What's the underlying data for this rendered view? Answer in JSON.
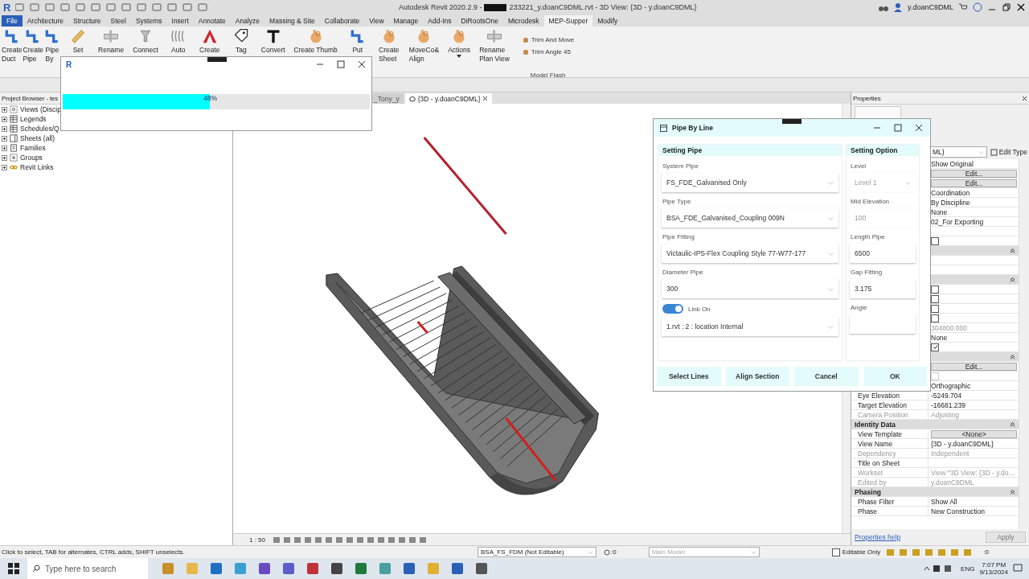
{
  "title_bar": {
    "logo": "R",
    "app": "Autodesk Revit 2020.2.9 -",
    "document": "233221_y.doanC9DML.rvt - 3D View: {3D - y.doanC9DML}",
    "user": "y.doanC9DML"
  },
  "ribbon_tabs": [
    {
      "label": "File",
      "selected": false,
      "kind": "file"
    },
    {
      "label": "Architecture",
      "selected": false,
      "kind": "tab"
    },
    {
      "label": "Structure",
      "selected": false,
      "kind": "tab"
    },
    {
      "label": "Steel",
      "selected": false,
      "kind": "tab"
    },
    {
      "label": "Systems",
      "selected": false,
      "kind": "tab"
    },
    {
      "label": "Insert",
      "selected": false,
      "kind": "tab"
    },
    {
      "label": "Annotate",
      "selected": false,
      "kind": "tab"
    },
    {
      "label": "Analyze",
      "selected": false,
      "kind": "tab"
    },
    {
      "label": "Massing & Site",
      "selected": false,
      "kind": "tab"
    },
    {
      "label": "Collaborate",
      "selected": false,
      "kind": "tab"
    },
    {
      "label": "View",
      "selected": false,
      "kind": "tab"
    },
    {
      "label": "Manage",
      "selected": false,
      "kind": "tab"
    },
    {
      "label": "Add-Ins",
      "selected": false,
      "kind": "tab"
    },
    {
      "label": "DiRootsOne",
      "selected": false,
      "kind": "tab"
    },
    {
      "label": "Microdesk",
      "selected": false,
      "kind": "tab"
    },
    {
      "label": "MEP-Supper",
      "selected": true,
      "kind": "tab"
    },
    {
      "label": "Modify",
      "selected": false,
      "kind": "tab"
    }
  ],
  "ribbon_buttons": [
    {
      "lines": [
        "Create",
        "Duct"
      ],
      "kind": "pipe"
    },
    {
      "lines": [
        "Create",
        "Pipe"
      ],
      "kind": "pipe"
    },
    {
      "lines": [
        "Pipe",
        "By"
      ],
      "kind": "pipe"
    },
    {
      "lines": [
        "Set"
      ],
      "kind": "ruler"
    },
    {
      "lines": [
        "Rename"
      ],
      "kind": "beam"
    },
    {
      "lines": [
        "Connect"
      ],
      "kind": "connect"
    },
    {
      "lines": [
        "Auto"
      ],
      "kind": "spring"
    },
    {
      "lines": [
        "Create"
      ],
      "kind": "triangle"
    },
    {
      "lines": [
        "Tag"
      ],
      "kind": "tag"
    },
    {
      "lines": [
        "Convert"
      ],
      "kind": "tee"
    },
    {
      "lines": [
        "Create Thumb"
      ],
      "kind": "hand"
    },
    {
      "lines": [
        "Put"
      ],
      "kind": "pipe"
    },
    {
      "lines": [
        "Create",
        "Sheet"
      ],
      "kind": "hand"
    },
    {
      "lines": [
        "MoveCo&",
        "Align"
      ],
      "kind": "hand"
    },
    {
      "lines": [
        "Actions"
      ],
      "kind": "hand",
      "dropdown": true
    },
    {
      "lines": [
        "Rename",
        "Plan View"
      ],
      "kind": "beam"
    }
  ],
  "ribbon_small_buttons": [
    "Trim And Move",
    "Trim Angle 45"
  ],
  "ribbon_panel_label": "Model Flash",
  "project_browser": {
    "title": "Project Browser - tes",
    "items": [
      {
        "label": "Views (Discip",
        "kind": "views"
      },
      {
        "label": "Legends",
        "kind": "grid"
      },
      {
        "label": "Schedules/Q",
        "kind": "grid"
      },
      {
        "label": "Sheets (all)",
        "kind": "sheet"
      },
      {
        "label": "Families",
        "kind": "family"
      },
      {
        "label": "Groups",
        "kind": "group"
      },
      {
        "label": "Revit Links",
        "kind": "link"
      }
    ]
  },
  "view_tabs": [
    {
      "label": "_Tony_y",
      "selected": false
    },
    {
      "label": "{3D - y.doanC9DML}",
      "selected": true
    }
  ],
  "view_scale": "1 : 50",
  "properties": {
    "title": "Properties",
    "type_selector": "ML)",
    "edit_type": "Edit Type",
    "rows": [
      {
        "kind": "text",
        "value": "Show Original"
      },
      {
        "kind": "button",
        "value": "Edit..."
      },
      {
        "kind": "button",
        "value": "Edit..."
      },
      {
        "kind": "text",
        "value": "Coordination"
      },
      {
        "kind": "text",
        "value": "By Discipline"
      },
      {
        "kind": "text",
        "value": "None"
      },
      {
        "kind": "text",
        "value": "02_For Exporting"
      },
      {
        "kind": "empty"
      },
      {
        "kind": "checkbox",
        "checked": false,
        "disabled": false
      },
      {
        "kind": "group"
      },
      {
        "kind": "empty"
      },
      {
        "kind": "empty"
      },
      {
        "kind": "group"
      },
      {
        "kind": "checkbox",
        "checked": false,
        "disabled": false
      },
      {
        "kind": "checkbox",
        "checked": false,
        "disabled": false
      },
      {
        "kind": "checkbox",
        "checked": false,
        "disabled": false
      },
      {
        "kind": "checkbox",
        "checked": false,
        "disabled": false
      },
      {
        "kind": "grey",
        "value": "304800.000"
      },
      {
        "kind": "text",
        "value": "None"
      },
      {
        "kind": "checkbox",
        "checked": true,
        "disabled": false
      },
      {
        "kind": "group"
      },
      {
        "kind": "button",
        "value": "Edit..."
      },
      {
        "kind": "checkbox",
        "checked": false,
        "disabled": true
      },
      {
        "kind": "text",
        "value": "Orthographic"
      },
      {
        "kind": "text",
        "label": "Eye Elevation",
        "value": "-5249.704"
      },
      {
        "kind": "text",
        "label": "Target Elevation",
        "value": "-16681.239"
      },
      {
        "kind": "grey",
        "label": "Camera Position",
        "value": "Adjusting"
      },
      {
        "kind": "group",
        "label": "Identity Data"
      },
      {
        "kind": "button",
        "label": "View Template",
        "value": "<None>"
      },
      {
        "kind": "text",
        "label": "View Name",
        "value": "{3D - y.doanC9DML}"
      },
      {
        "kind": "grey",
        "label": "Dependency",
        "value": "Independent"
      },
      {
        "kind": "empty",
        "label": "Title on Sheet"
      },
      {
        "kind": "grey",
        "label": "Workset",
        "value": "View \"3D View: {3D - y.do..."
      },
      {
        "kind": "grey",
        "label": "Edited by",
        "value": "y.doanC9DML"
      },
      {
        "kind": "group",
        "label": "Phasing"
      },
      {
        "kind": "text",
        "label": "Phase Filter",
        "value": "Show All"
      },
      {
        "kind": "text",
        "label": "Phase",
        "value": "New Construction"
      }
    ],
    "help_link": "Properties help",
    "apply": "Apply"
  },
  "status_bar": {
    "message": "Click to select, TAB for alternates, CTRL adds, SHIFT unselects.",
    "workset": "BSA_FS_FDM (Not Editable)",
    "selection_count": ":0",
    "design_option": "Main Model",
    "editable_only": {
      "label": "Editable Only",
      "checked": false
    },
    "filter_count": ":0"
  },
  "taskbar": {
    "search_placeholder": "Type here to search",
    "language": "ENG",
    "time": "7:07 PM",
    "date": "9/13/2024"
  },
  "progress_window": {
    "logo": "R",
    "level": 0.48,
    "percent": "48%"
  },
  "pipe_dialog": {
    "title": "Pipe By Line",
    "left_header": "Setting Pipe",
    "right_header": "Setting Option",
    "left_fields": [
      {
        "kind": "select",
        "label": "System Pipe",
        "value": "FS_FDE_Galvanised Only"
      },
      {
        "kind": "select",
        "label": "Pipe Type",
        "value": "BSA_FDE_Galvanised_Coupling 009N"
      },
      {
        "kind": "select",
        "label": "Pipe Fitting",
        "value": "Victaulic-IPS-Flex Coupling Style 77-W77-177"
      },
      {
        "kind": "select",
        "label": "Diameter Pipe",
        "value": "300"
      },
      {
        "kind": "toggle",
        "label": "Link On",
        "on": true
      },
      {
        "kind": "select",
        "value": "1.rvt : 2 : location Internal"
      }
    ],
    "right_fields": [
      {
        "kind": "select",
        "label": "Level",
        "value": "Level 1",
        "disabled": true
      },
      {
        "kind": "input",
        "label": "Mid Elevation",
        "value": "100",
        "disabled": true
      },
      {
        "kind": "input",
        "label": "Length Pipe",
        "value": "6500",
        "disabled": false
      },
      {
        "kind": "input",
        "label": "Gap Fitting",
        "value": "3.175",
        "disabled": false
      },
      {
        "kind": "input",
        "label": "Angle",
        "disabled": false
      }
    ],
    "buttons": [
      "Select Lines",
      "Align Section",
      "Cancel",
      "OK"
    ]
  }
}
